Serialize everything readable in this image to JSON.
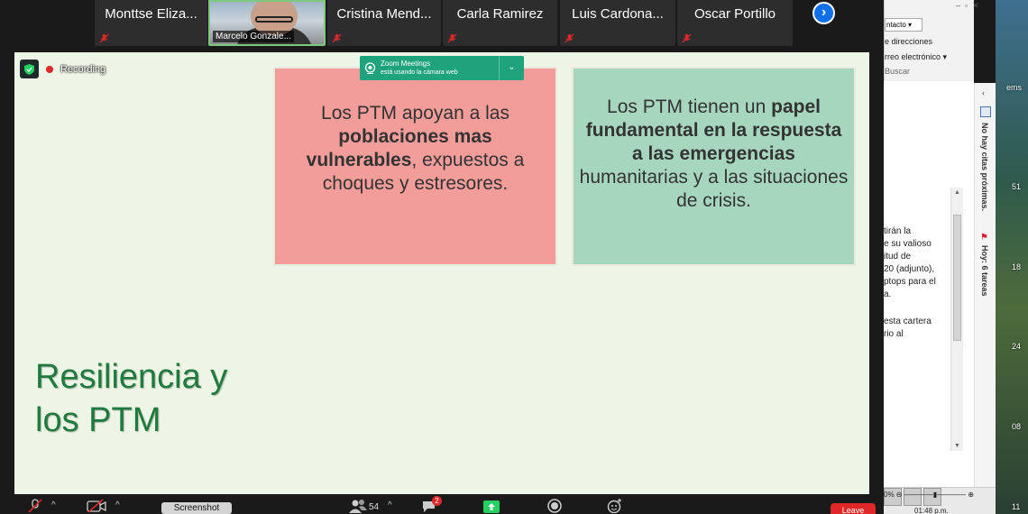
{
  "participants": [
    {
      "name": "Monttse Eliza..."
    },
    {
      "name": "Marcelo Gonzale..."
    },
    {
      "name": "Cristina Mend..."
    },
    {
      "name": "Carla Ramirez"
    },
    {
      "name": "Luis Cardona..."
    },
    {
      "name": "Oscar Portillo"
    }
  ],
  "recording": {
    "label": "Recording"
  },
  "notification": {
    "title": "Zoom Meetings",
    "text": "está usando la cámara web"
  },
  "slide": {
    "box1": {
      "p1": "Los PTM apoyan a las ",
      "b1": "poblaciones mas vulnerables",
      "p2": ", expuestos a choques y estresores."
    },
    "box2": {
      "p1": "Los PTM tienen un ",
      "b1": "papel fundamental en la respuesta a las emergencias",
      "p2": " humanitarias y a las situaciones de crisis."
    },
    "title_line1": "Resiliencia y",
    "title_line2": "los PTM"
  },
  "toolbar": {
    "screenshot_label": "Screenshot",
    "participants_count": "54",
    "chat_badge": "2",
    "leave_label": "Leave"
  },
  "outlook": {
    "contact_combo": "ntacto",
    "address_book": "e direcciones",
    "email_menu": "rreo electrónico",
    "search": "Buscar",
    "body_lines": [
      "tirán la",
      "e su valioso",
      "itud de",
      "20 (adjunto),",
      "ptops para el",
      "a.",
      "",
      "esta cartera",
      "rio al"
    ],
    "no_appointments": "No hay citas próximas.",
    "tasks": "Hoy: 6 tareas",
    "zoom_level": "0%",
    "time": "01:48 p.m."
  },
  "desktop": {
    "labels": [
      "ems",
      "51",
      "18",
      "24",
      "08",
      "11"
    ]
  }
}
